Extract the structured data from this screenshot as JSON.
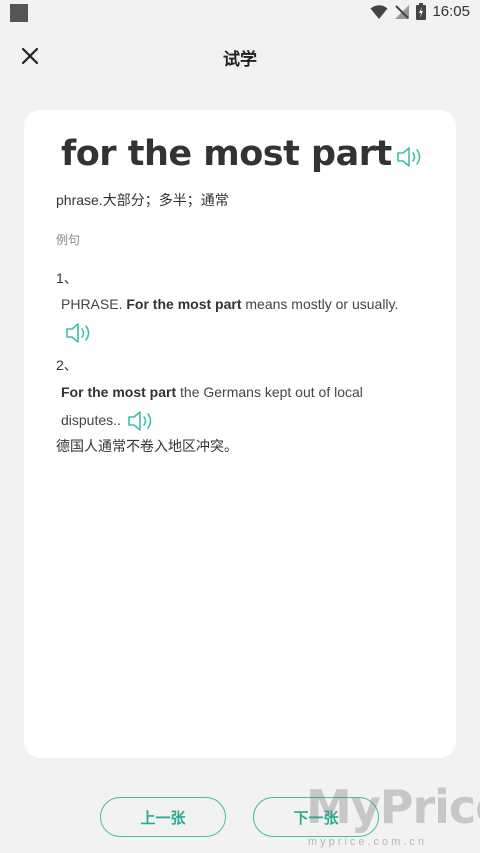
{
  "status_bar": {
    "time": "16:05",
    "icons": [
      "app-square-icon",
      "wifi-icon",
      "no-signal-icon",
      "battery-icon"
    ]
  },
  "header": {
    "title": "试学",
    "close_icon": "close-icon"
  },
  "card": {
    "headword": "for the most part",
    "definition": "phrase.大部分；多半；通常",
    "examples_label": "例句",
    "examples": [
      {
        "number": "1、",
        "bold_prefix": "",
        "text_before_bold": "PHRASE. ",
        "bold": "For the most part",
        "text_after_bold": " means mostly or usually.",
        "translation": ""
      },
      {
        "number": "2、",
        "text_before_bold": "",
        "bold": "For the most part",
        "text_after_bold": " the Germans kept out of local disputes..",
        "translation": "德国人通常不卷入地区冲突。"
      }
    ]
  },
  "buttons": {
    "prev": "上一张",
    "next": "下一张"
  },
  "watermark": {
    "main": "MyPrice",
    "sub": "myprice.com.cn"
  },
  "colors": {
    "accent": "#3fbfa6",
    "background": "#f2f2f2",
    "card": "#ffffff"
  }
}
